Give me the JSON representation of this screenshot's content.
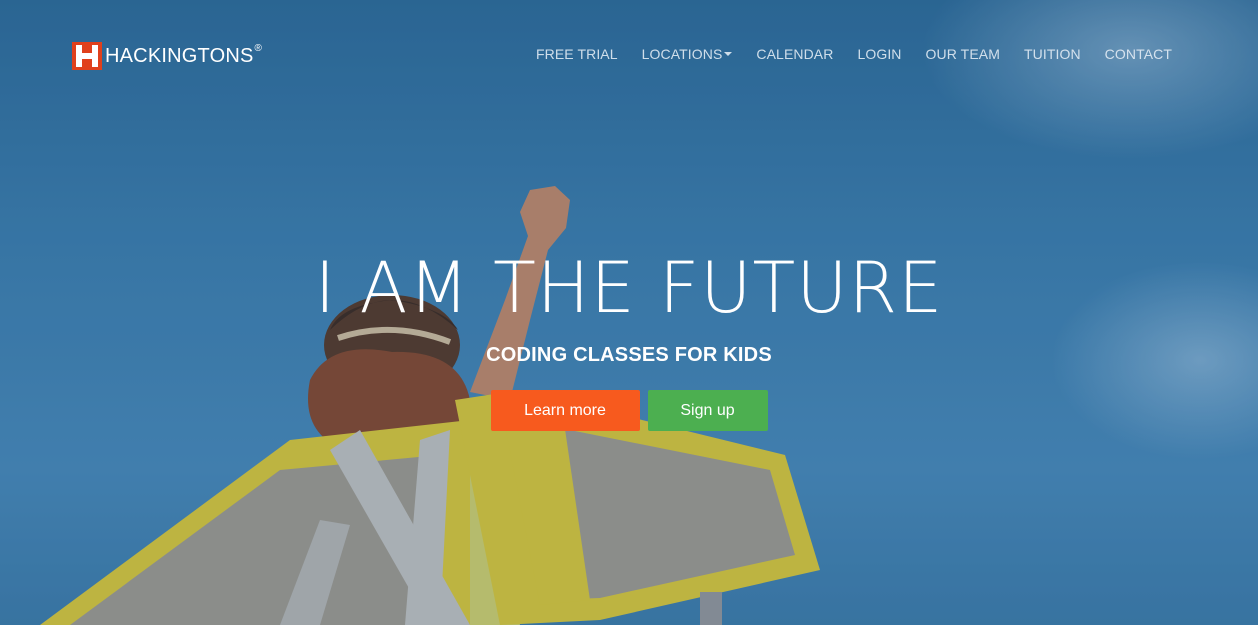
{
  "brand": {
    "name": "HACKINGTONS",
    "registered": "®"
  },
  "nav": {
    "items": [
      {
        "label": "FREE TRIAL"
      },
      {
        "label": "LOCATIONS"
      },
      {
        "label": "CALENDAR"
      },
      {
        "label": "LOGIN"
      },
      {
        "label": "OUR TEAM"
      },
      {
        "label": "TUITION"
      },
      {
        "label": "CONTACT"
      }
    ]
  },
  "hero": {
    "title": "I AM THE FUTURE",
    "subtitle": "CODING CLASSES FOR KIDS",
    "primary_cta": "Learn more",
    "secondary_cta": "Sign up"
  },
  "colors": {
    "brand_accent": "#e0401c",
    "primary_button": "#f75a1e",
    "success_button": "#4caf50",
    "sky": "#3f82b3"
  },
  "icons": {
    "logo": "hackingtons-logo-icon",
    "dropdown": "caret-down-icon"
  }
}
